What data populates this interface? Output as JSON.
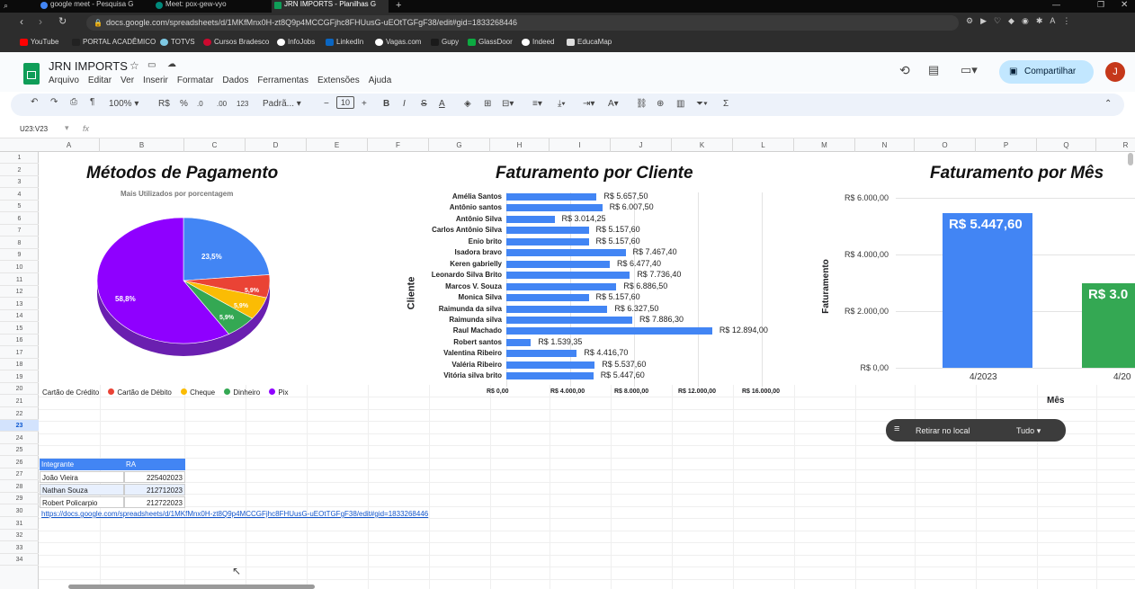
{
  "browser": {
    "tabs": [
      {
        "label": "google meet - Pesquisa G"
      },
      {
        "label": "Meet: pox-gew-vyo"
      },
      {
        "label": "JRN IMPORTS - Planilhas G"
      }
    ],
    "url": "docs.google.com/spreadsheets/d/1MKfMnx0H-zt8Q9p4MCCGFjhc8FHUusG-uEOtTGFgF38/edit#gid=1833268446",
    "bookmarks": [
      "YouTube",
      "PORTAL ACADÊMICO",
      "TOTVS",
      "Cursos Bradesco",
      "InfoJobs",
      "LinkedIn",
      "Vagas.com",
      "Gupy",
      "GlassDoor",
      "Indeed",
      "EducaMap"
    ]
  },
  "app": {
    "title": "JRN IMPORTS",
    "menu": [
      "Arquivo",
      "Editar",
      "Ver",
      "Inserir",
      "Formatar",
      "Dados",
      "Ferramentas",
      "Extensões",
      "Ajuda"
    ],
    "share_label": "Compartilhar",
    "avatar_letter": "J"
  },
  "toolbar": {
    "zoom": "100%",
    "currency": "R$",
    "percent": "%",
    "dec_down": ".0",
    "dec_up": ".00",
    "num_format": "123",
    "font": "Padrã...",
    "font_size": "10"
  },
  "formula_bar": {
    "cell_ref": "U23:V23",
    "fx": "fx"
  },
  "columns": [
    "A",
    "B",
    "C",
    "D",
    "E",
    "F",
    "G",
    "H",
    "I",
    "J",
    "K",
    "L",
    "M",
    "N",
    "O",
    "P",
    "Q",
    "R"
  ],
  "rows": [
    "1",
    "2",
    "3",
    "4",
    "5",
    "6",
    "7",
    "8",
    "9",
    "10",
    "11",
    "12",
    "13",
    "14",
    "15",
    "16",
    "17",
    "18",
    "19",
    "20",
    "21",
    "22",
    "23",
    "24",
    "25",
    "26",
    "27",
    "28",
    "29",
    "30",
    "31",
    "32",
    "33",
    "34"
  ],
  "selected_row": "23",
  "pie_chart": {
    "title": "Métodos de Pagamento",
    "subtitle": "Mais Utilizados por porcentagem",
    "labels": [
      "23,5%",
      "5,9%",
      "5,9%",
      "5,9%",
      "58,8%"
    ],
    "legend": [
      "Cartão de Crédito",
      "Cartão de Débito",
      "Cheque",
      "Dinheiro",
      "Pix"
    ],
    "colors": [
      "#4285f4",
      "#ea4335",
      "#fbbc04",
      "#34a853",
      "#8f00ff"
    ]
  },
  "bar_chart": {
    "title": "Faturamento por Cliente",
    "ylabel": "Cliente",
    "clients": [
      "Amélia Santos",
      "Antônio santos",
      "Antônio Silva",
      "Carlos Antônio Silva",
      "Enio brito",
      "Isadora bravo",
      "Keren gabrielly",
      "Leonardo Silva Brito",
      "Marcos V. Souza",
      "Monica Silva",
      "Raimunda da silva",
      "Raimunda silva",
      "Raul Machado",
      "Robert santos",
      "Valentina Ribeiro",
      "Valéria Ribeiro",
      "Vitória silva brito"
    ],
    "value_labels": [
      "R$ 5.657,50",
      "R$ 6.007,50",
      "R$ 3.014,25",
      "R$ 5.157,60",
      "R$ 5.157,60",
      "R$ 7.467,40",
      "R$ 6.477,40",
      "R$ 7.736,40",
      "R$ 6.886,50",
      "R$ 5.157,60",
      "R$ 6.327,50",
      "R$ 7.886,30",
      "R$ 12.894,00",
      "R$ 1.539,35",
      "R$ 4.416,70",
      "R$ 5.537,60",
      "R$ 5.447,60"
    ],
    "ticks": [
      "R$ 0,00",
      "R$ 4.000,00",
      "R$ 8.000,00",
      "R$ 12.000,00",
      "R$ 16.000,00"
    ]
  },
  "month_chart": {
    "title": "Faturamento por Mês",
    "ylabel": "Faturamento",
    "xlabel": "Mês",
    "ticks": [
      "R$ 6.000,00",
      "R$ 4.000,00",
      "R$ 2.000,00",
      "R$ 0,00"
    ],
    "bar1_label": "R$ 5.447,60",
    "bar2_label": "R$ 3.0",
    "cat1": "4/2023",
    "cat2": "4/20"
  },
  "chart_data": [
    {
      "type": "pie",
      "title": "Métodos de Pagamento",
      "subtitle": "Mais Utilizados por porcentagem",
      "categories": [
        "Cartão de Crédito",
        "Cartão de Débito",
        "Cheque",
        "Dinheiro",
        "Pix"
      ],
      "values": [
        23.5,
        5.9,
        5.9,
        5.9,
        58.8
      ]
    },
    {
      "type": "bar",
      "title": "Faturamento por Cliente",
      "ylabel": "Cliente",
      "categories": [
        "Amélia Santos",
        "Antônio santos",
        "Antônio Silva",
        "Carlos Antônio Silva",
        "Enio brito",
        "Isadora bravo",
        "Keren gabrielly",
        "Leonardo Silva Brito",
        "Marcos V. Souza",
        "Monica Silva",
        "Raimunda da silva",
        "Raimunda silva",
        "Raul Machado",
        "Robert santos",
        "Valentina Ribeiro",
        "Valéria Ribeiro",
        "Vitória silva brito"
      ],
      "values": [
        5657.5,
        6007.5,
        3014.25,
        5157.6,
        5157.6,
        7467.4,
        6477.4,
        7736.4,
        6886.5,
        5157.6,
        6327.5,
        7886.3,
        12894,
        1539.35,
        4416.7,
        5537.6,
        5447.6
      ],
      "xlim": [
        0,
        16000
      ]
    },
    {
      "type": "bar",
      "title": "Faturamento por Mês",
      "xlabel": "Mês",
      "ylabel": "Faturamento",
      "categories": [
        "4/2023",
        "4/20"
      ],
      "values": [
        5447.6,
        3000
      ],
      "ylim": [
        0,
        6000
      ]
    }
  ],
  "filter_popup": {
    "label": "Retirar no local",
    "value": "Tudo"
  },
  "team_table": {
    "headers": [
      "Integrante",
      "RA"
    ],
    "rows": [
      [
        "João Vieira",
        "225402023"
      ],
      [
        "Nathan Souza",
        "212712023"
      ],
      [
        "Robert Policarpio",
        "212722023"
      ]
    ]
  },
  "sheet_link": "https://docs.google.com/spreadsheets/d/1MKfMnx0H-zt8Q9p4MCCGFjhc8FHUusG-uEOtTGFgF38/edit#gid=1833268446"
}
